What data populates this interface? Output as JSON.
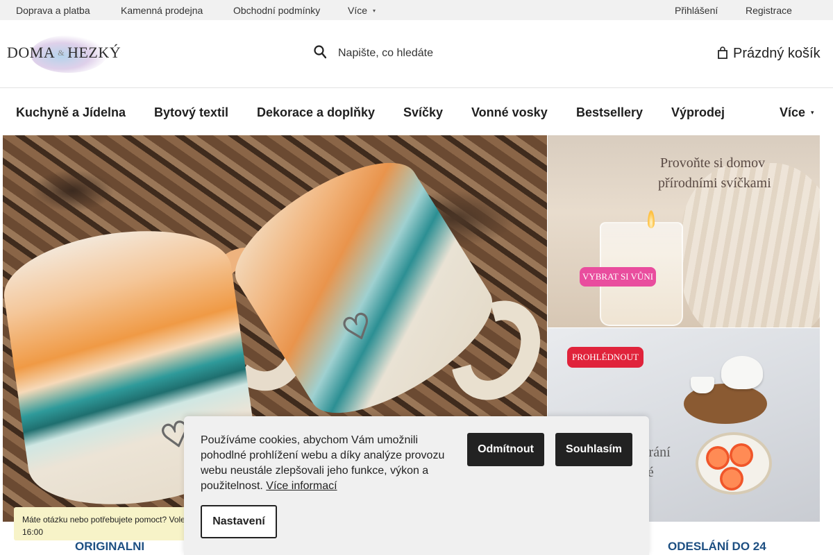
{
  "topbar": {
    "links": [
      "Doprava a platba",
      "Kamenná prodejna",
      "Obchodní podmínky"
    ],
    "more_label": "Více",
    "login": "Přihlášení",
    "register": "Registrace"
  },
  "header": {
    "logo_left": "DOMA",
    "logo_amp": "&",
    "logo_right": "HEZKÝ",
    "search_placeholder": "Napište, co hledáte",
    "cart_label": "Prázdný košík"
  },
  "nav": {
    "items": [
      "Kuchyně a Jídelna",
      "Bytový textil",
      "Dekorace a doplňky",
      "Svíčky",
      "Vonné vosky",
      "Bestsellery",
      "Výprodej"
    ],
    "more_label": "Více"
  },
  "banners": {
    "top_right_line1": "Provoňte si domov",
    "top_right_line2": "přírodními svíčkami",
    "top_right_button": "VYBRAT SI VŮNI",
    "bottom_right_button": "PROHLÉDNOUT",
    "bottom_right_text1": "írání",
    "bottom_right_text2": "čné"
  },
  "features": {
    "left_label": "ORIGINALNI",
    "right_label": "ODESLÁNÍ DO 24"
  },
  "chat": {
    "line1": "Máte otázku nebo potřebujete pomoct? Vole",
    "line2": "16:00"
  },
  "cookie": {
    "text": "Používáme cookies, abychom Vám umožnili pohodlné prohlížení webu a díky analýze provozu webu neustále zlepšovali jeho funkce, výkon a použitelnost.",
    "more_info": "Více informací",
    "decline": "Odmítnout",
    "accept": "Souhlasím",
    "settings": "Nastavení"
  },
  "colors": {
    "topbar_bg": "#f1f1f1",
    "feature_blue": "#1d4f82",
    "chat_bg": "#f7f3c8",
    "pink_button": "#e94d9e",
    "red_button": "#e0233b"
  }
}
